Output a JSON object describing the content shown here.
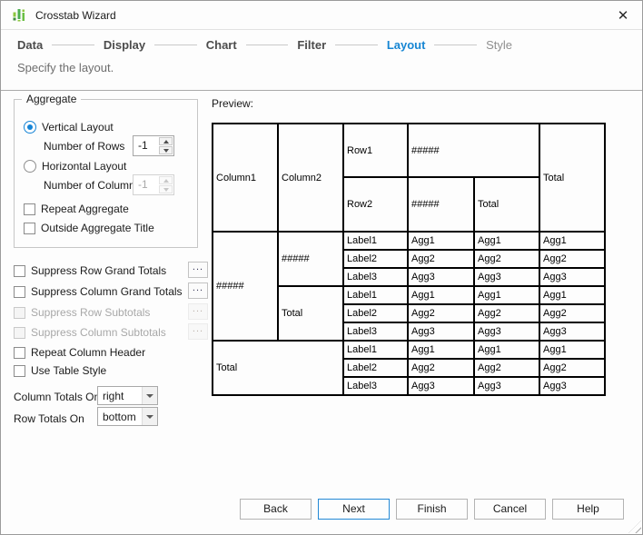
{
  "window": {
    "title": "Crosstab Wizard"
  },
  "colors": {
    "accent_blue": "#1786d3",
    "icon_green_light": "#8dc63f",
    "icon_green_dark": "#4caf50",
    "table_border": "#000000"
  },
  "steps": [
    {
      "label": "Data",
      "state": "done"
    },
    {
      "label": "Display",
      "state": "done"
    },
    {
      "label": "Chart",
      "state": "done"
    },
    {
      "label": "Filter",
      "state": "done"
    },
    {
      "label": "Layout",
      "state": "active"
    },
    {
      "label": "Style",
      "state": "upcoming"
    }
  ],
  "subtitle": "Specify the layout.",
  "aggregate": {
    "group_label": "Aggregate",
    "vertical_layout": {
      "label": "Vertical Layout",
      "selected": true,
      "field_label": "Number of Rows",
      "value": "-1",
      "enabled": true
    },
    "horizontal_layout": {
      "label": "Horizontal Layout",
      "selected": false,
      "field_label": "Number of Columns",
      "value": "-1",
      "enabled": false
    },
    "repeat_aggregate": {
      "label": "Repeat Aggregate",
      "checked": false
    },
    "outside_aggregate_title": {
      "label": "Outside Aggregate Title",
      "checked": false
    }
  },
  "options": [
    {
      "label": "Suppress Row Grand Totals",
      "checked": false,
      "enabled": true,
      "more_label": "..."
    },
    {
      "label": "Suppress Column Grand Totals",
      "checked": false,
      "enabled": true,
      "more_label": "..."
    },
    {
      "label": "Suppress Row Subtotals",
      "checked": false,
      "enabled": false,
      "more_label": "..."
    },
    {
      "label": "Suppress Column Subtotals",
      "checked": false,
      "enabled": false,
      "more_label": "..."
    },
    {
      "label": "Repeat Column Header",
      "checked": false,
      "enabled": true
    },
    {
      "label": "Use Table Style",
      "checked": false,
      "enabled": true
    }
  ],
  "totals": {
    "column_totals_on": {
      "label": "Column Totals On",
      "value": "right"
    },
    "row_totals_on": {
      "label": "Row Totals On",
      "value": "bottom"
    }
  },
  "preview": {
    "label": "Preview:",
    "header": {
      "column1": "Column1",
      "column2": "Column2",
      "row1": "Row1",
      "row1_value": "#####",
      "row2": "Row2",
      "row2_value": "#####",
      "row2_total": "Total",
      "grand_total": "Total"
    },
    "body": {
      "row_group": "#####",
      "col_group": "#####",
      "col_total": "Total",
      "grand_total": "Total",
      "labels": [
        "Label1",
        "Label2",
        "Label3"
      ],
      "aggs": [
        "Agg1",
        "Agg2",
        "Agg3"
      ]
    }
  },
  "footer": {
    "buttons": [
      {
        "label": "Back",
        "default": false
      },
      {
        "label": "Next",
        "default": true
      },
      {
        "label": "Finish",
        "default": false
      },
      {
        "label": "Cancel",
        "default": false
      },
      {
        "label": "Help",
        "default": false
      }
    ]
  }
}
